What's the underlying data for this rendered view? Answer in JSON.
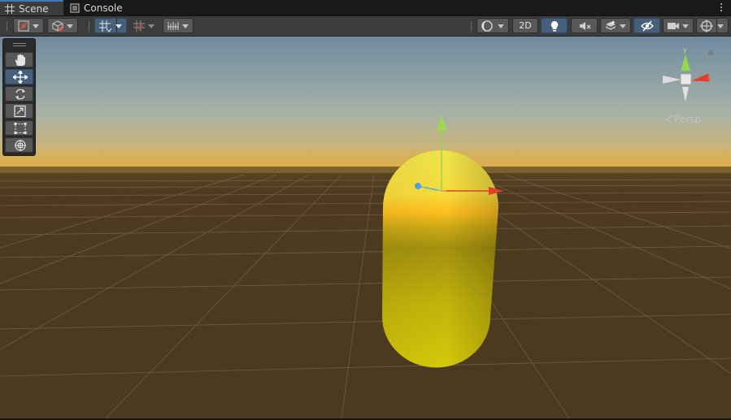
{
  "tabs": [
    {
      "label": "Scene",
      "icon": "grid-icon",
      "active": true
    },
    {
      "label": "Console",
      "icon": "console-icon",
      "active": false
    }
  ],
  "toolbar": {
    "mode_2d_label": "2D"
  },
  "tools": [
    "hand",
    "move",
    "rotate",
    "scale",
    "rect",
    "transform"
  ],
  "active_tool": "move",
  "gizmo": {
    "y_label": "y",
    "x_label": "x",
    "projection_label": "Persp"
  },
  "colors": {
    "accent": "#46607c",
    "capsule": "#d8c400",
    "ground": "#4a3a1f",
    "sky_top": "#6f8aa0",
    "horizon": "#d9b24a"
  }
}
